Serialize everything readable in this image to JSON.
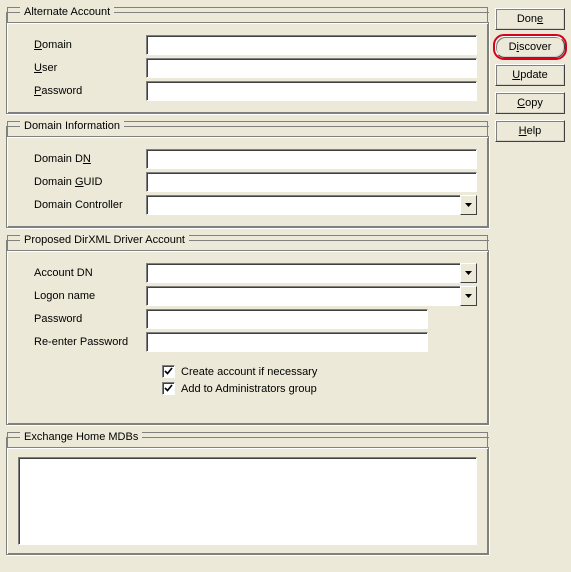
{
  "groups": {
    "alt_account": {
      "legend": "Alternate Account",
      "domain_label_pre": "",
      "domain_label_u": "D",
      "domain_label_post": "omain",
      "user_label_pre": "",
      "user_label_u": "U",
      "user_label_post": "ser",
      "password_label_pre": "",
      "password_label_u": "P",
      "password_label_post": "assword",
      "domain_value": "",
      "user_value": "",
      "password_value": ""
    },
    "domain_info": {
      "legend": "Domain Information",
      "dn_label_pre": "Domain D",
      "dn_label_u": "N",
      "dn_label_post": "",
      "guid_label_pre": "Domain ",
      "guid_label_u": "G",
      "guid_label_post": "UID",
      "controller_label": "Domain Controller",
      "dn_value": "",
      "guid_value": "",
      "controller_value": ""
    },
    "driver_account": {
      "legend": "Proposed DirXML Driver Account",
      "account_dn_label": "Account DN",
      "logon_label": "Logon name",
      "password_label": "Password",
      "reenter_label": "Re-enter Password",
      "account_dn_value": "",
      "logon_value": "",
      "password_value": "",
      "reenter_value": "",
      "chk_create_label": "Create account if necessary",
      "chk_admin_label": "Add to Administrators group",
      "chk_create_checked": true,
      "chk_admin_checked": true
    },
    "exchange": {
      "legend": "Exchange Home MDBs"
    }
  },
  "buttons": {
    "done_pre": "Don",
    "done_u": "e",
    "done_post": "",
    "discover_pre": "D",
    "discover_u": "i",
    "discover_post": "scover",
    "update_pre": "",
    "update_u": "U",
    "update_post": "pdate",
    "copy_pre": "",
    "copy_u": "C",
    "copy_post": "opy",
    "help_pre": "",
    "help_u": "H",
    "help_post": "elp"
  }
}
